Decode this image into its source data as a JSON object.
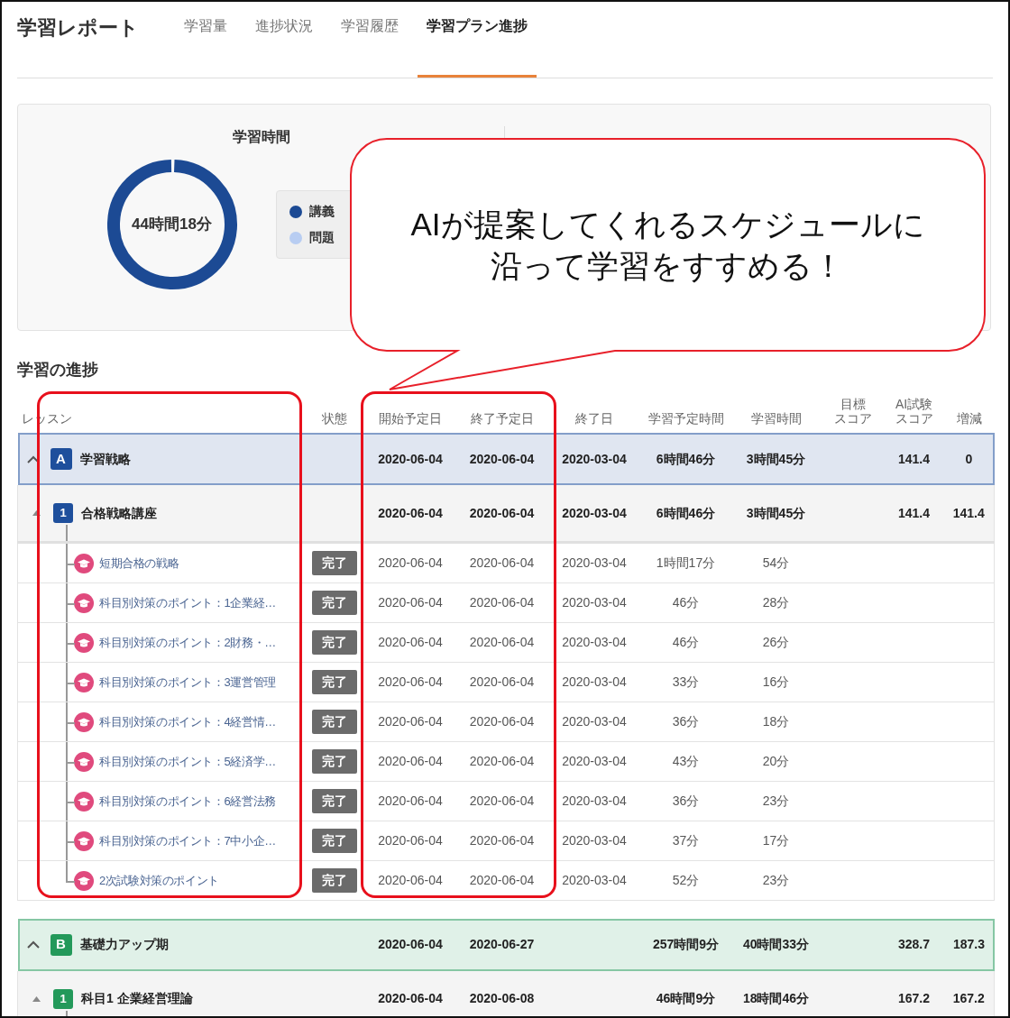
{
  "app_title": "学習レポート",
  "tabs": [
    {
      "label": "学習量",
      "selected": false
    },
    {
      "label": "進捗状況",
      "selected": false
    },
    {
      "label": "学習履歴",
      "selected": false
    },
    {
      "label": "学習プラン進捗",
      "selected": true
    }
  ],
  "summary": {
    "title": "学習時間",
    "total": "44時間18分",
    "legend": [
      {
        "label": "講義",
        "color": "#1c4a94"
      },
      {
        "label": "問題",
        "color": "#b8cdf2"
      }
    ]
  },
  "section_title": "学習の進捗",
  "columns": [
    [
      "レッスン"
    ],
    [
      "状態"
    ],
    [
      "開始予定日"
    ],
    [
      "終了予定日"
    ],
    [
      "終了日"
    ],
    [
      "学習予定時間"
    ],
    [
      "学習時間"
    ],
    [
      "目標",
      "スコア"
    ],
    [
      "AI試験",
      "スコア"
    ],
    [
      "増減"
    ]
  ],
  "phases": [
    {
      "badge": "A",
      "title": "学習戦略",
      "color": "#1e4f9c",
      "expanded": true,
      "start": "2020-06-04",
      "end": "2020-06-04",
      "done": "2020-03-04",
      "planned": "6時間46分",
      "actual": "3時間45分",
      "ai_score": "141.4",
      "diff": "0",
      "subjects": [
        {
          "badge": "1",
          "title": "合格戦略講座",
          "expanded": true,
          "start": "2020-06-04",
          "end": "2020-06-04",
          "done": "2020-03-04",
          "planned": "6時間46分",
          "actual": "3時間45分",
          "ai_score": "141.4",
          "diff": "141.4",
          "lessons": [
            {
              "title": "短期合格の戦略",
              "status": "完了",
              "start": "2020-06-04",
              "end": "2020-06-04",
              "done": "2020-03-04",
              "planned": "1時間17分",
              "actual": "54分"
            },
            {
              "title": "科目別対策のポイント：1企業経…",
              "status": "完了",
              "start": "2020-06-04",
              "end": "2020-06-04",
              "done": "2020-03-04",
              "planned": "46分",
              "actual": "28分"
            },
            {
              "title": "科目別対策のポイント：2財務・…",
              "status": "完了",
              "start": "2020-06-04",
              "end": "2020-06-04",
              "done": "2020-03-04",
              "planned": "46分",
              "actual": "26分"
            },
            {
              "title": "科目別対策のポイント：3運営管理",
              "status": "完了",
              "start": "2020-06-04",
              "end": "2020-06-04",
              "done": "2020-03-04",
              "planned": "33分",
              "actual": "16分"
            },
            {
              "title": "科目別対策のポイント：4経営情…",
              "status": "完了",
              "start": "2020-06-04",
              "end": "2020-06-04",
              "done": "2020-03-04",
              "planned": "36分",
              "actual": "18分"
            },
            {
              "title": "科目別対策のポイント：5経済学…",
              "status": "完了",
              "start": "2020-06-04",
              "end": "2020-06-04",
              "done": "2020-03-04",
              "planned": "43分",
              "actual": "20分"
            },
            {
              "title": "科目別対策のポイント：6経営法務",
              "status": "完了",
              "start": "2020-06-04",
              "end": "2020-06-04",
              "done": "2020-03-04",
              "planned": "36分",
              "actual": "23分"
            },
            {
              "title": "科目別対策のポイント：7中小企…",
              "status": "完了",
              "start": "2020-06-04",
              "end": "2020-06-04",
              "done": "2020-03-04",
              "planned": "37分",
              "actual": "17分"
            },
            {
              "title": "2次試験対策のポイント",
              "status": "完了",
              "start": "2020-06-04",
              "end": "2020-06-04",
              "done": "2020-03-04",
              "planned": "52分",
              "actual": "23分"
            }
          ]
        }
      ]
    },
    {
      "badge": "B",
      "title": "基礎力アップ期",
      "color": "#23995a",
      "expanded": true,
      "start": "2020-06-04",
      "end": "2020-06-27",
      "planned": "257時間9分",
      "actual": "40時間33分",
      "ai_score": "328.7",
      "diff": "187.3",
      "subjects": [
        {
          "badge": "1",
          "title": "科目1 企業経営理論",
          "expanded": true,
          "start": "2020-06-04",
          "end": "2020-06-08",
          "planned": "46時間9分",
          "actual": "18時間46分",
          "ai_score": "167.2",
          "diff": "167.2"
        }
      ]
    }
  ],
  "callout": {
    "lines": [
      "AIが提案してくれるスケジュールに",
      "沿って学習をすすめる！"
    ]
  }
}
